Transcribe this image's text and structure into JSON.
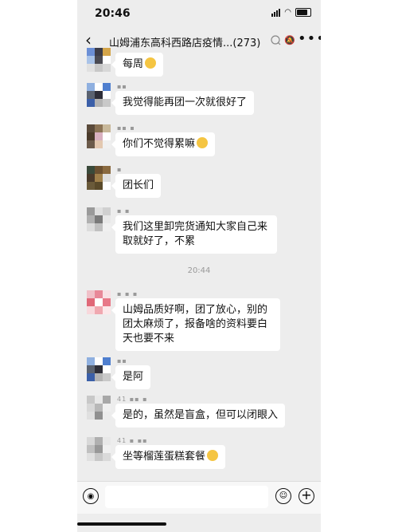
{
  "status": {
    "time": "20:46"
  },
  "nav": {
    "back": "‹",
    "title": "山姆浦东高科西路店疫情...",
    "count": "(273)",
    "more": "•••"
  },
  "messages": [
    {
      "sender": "",
      "text": "每周",
      "emoji": "laughing-face-icon"
    },
    {
      "sender": "",
      "text": "我觉得能再团一次就很好了"
    },
    {
      "sender": "",
      "text": "你们不觉得累嘛",
      "emoji": "laughing-face-icon"
    },
    {
      "sender": "",
      "text": "团长们"
    },
    {
      "sender": "",
      "text": "我们这里卸完货通知大家自己来取就好了，不累"
    },
    {
      "sender": "",
      "text": "山姆品质好啊，团了放心，别的团太麻烦了，报备啥的资料要白天也要不来"
    },
    {
      "sender": "",
      "text": "是阿"
    },
    {
      "sender": "41",
      "text": "是的，虽然是盲盒，但可以闭眼入"
    },
    {
      "sender": "41",
      "text": "坐等榴莲蛋糕套餐",
      "emoji": "grinning-face-icon"
    }
  ],
  "timestamp": "20:44",
  "input": {
    "placeholder": ""
  }
}
